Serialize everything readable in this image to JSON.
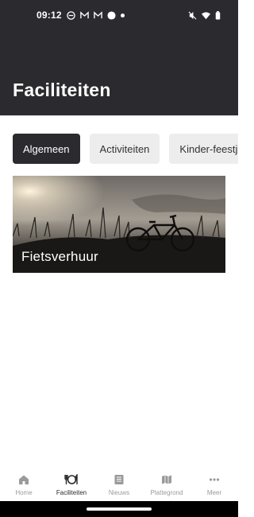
{
  "status_bar": {
    "time": "09:12",
    "left_icons": [
      "app-icon",
      "gmail-icon",
      "gmail-icon",
      "record-dot-icon",
      "small-dot-icon"
    ],
    "right_icons": [
      "mute-icon",
      "wifi-icon",
      "battery-icon"
    ]
  },
  "header": {
    "title": "Faciliteiten",
    "background": "#2b2a2e"
  },
  "chips": [
    {
      "label": "Algemeen",
      "active": true
    },
    {
      "label": "Activiteiten",
      "active": false
    },
    {
      "label": "Kinder-feestjes",
      "active": false
    }
  ],
  "cards": [
    {
      "label": "Fietsverhuur",
      "image": "bicycle-silhouette-sunset-photo"
    }
  ],
  "bottom_nav": [
    {
      "label": "Home",
      "icon": "home-icon",
      "active": false
    },
    {
      "label": "Faciliteiten",
      "icon": "dining-icon",
      "active": true
    },
    {
      "label": "Nieuws",
      "icon": "news-icon",
      "active": false
    },
    {
      "label": "Plattegrond",
      "icon": "map-icon",
      "active": false
    },
    {
      "label": "Meer",
      "icon": "more-icon",
      "active": false
    }
  ],
  "colors": {
    "accent_dark": "#2b2a2e",
    "chip_inactive": "#ededed",
    "nav_inactive": "#9a9a9a"
  }
}
